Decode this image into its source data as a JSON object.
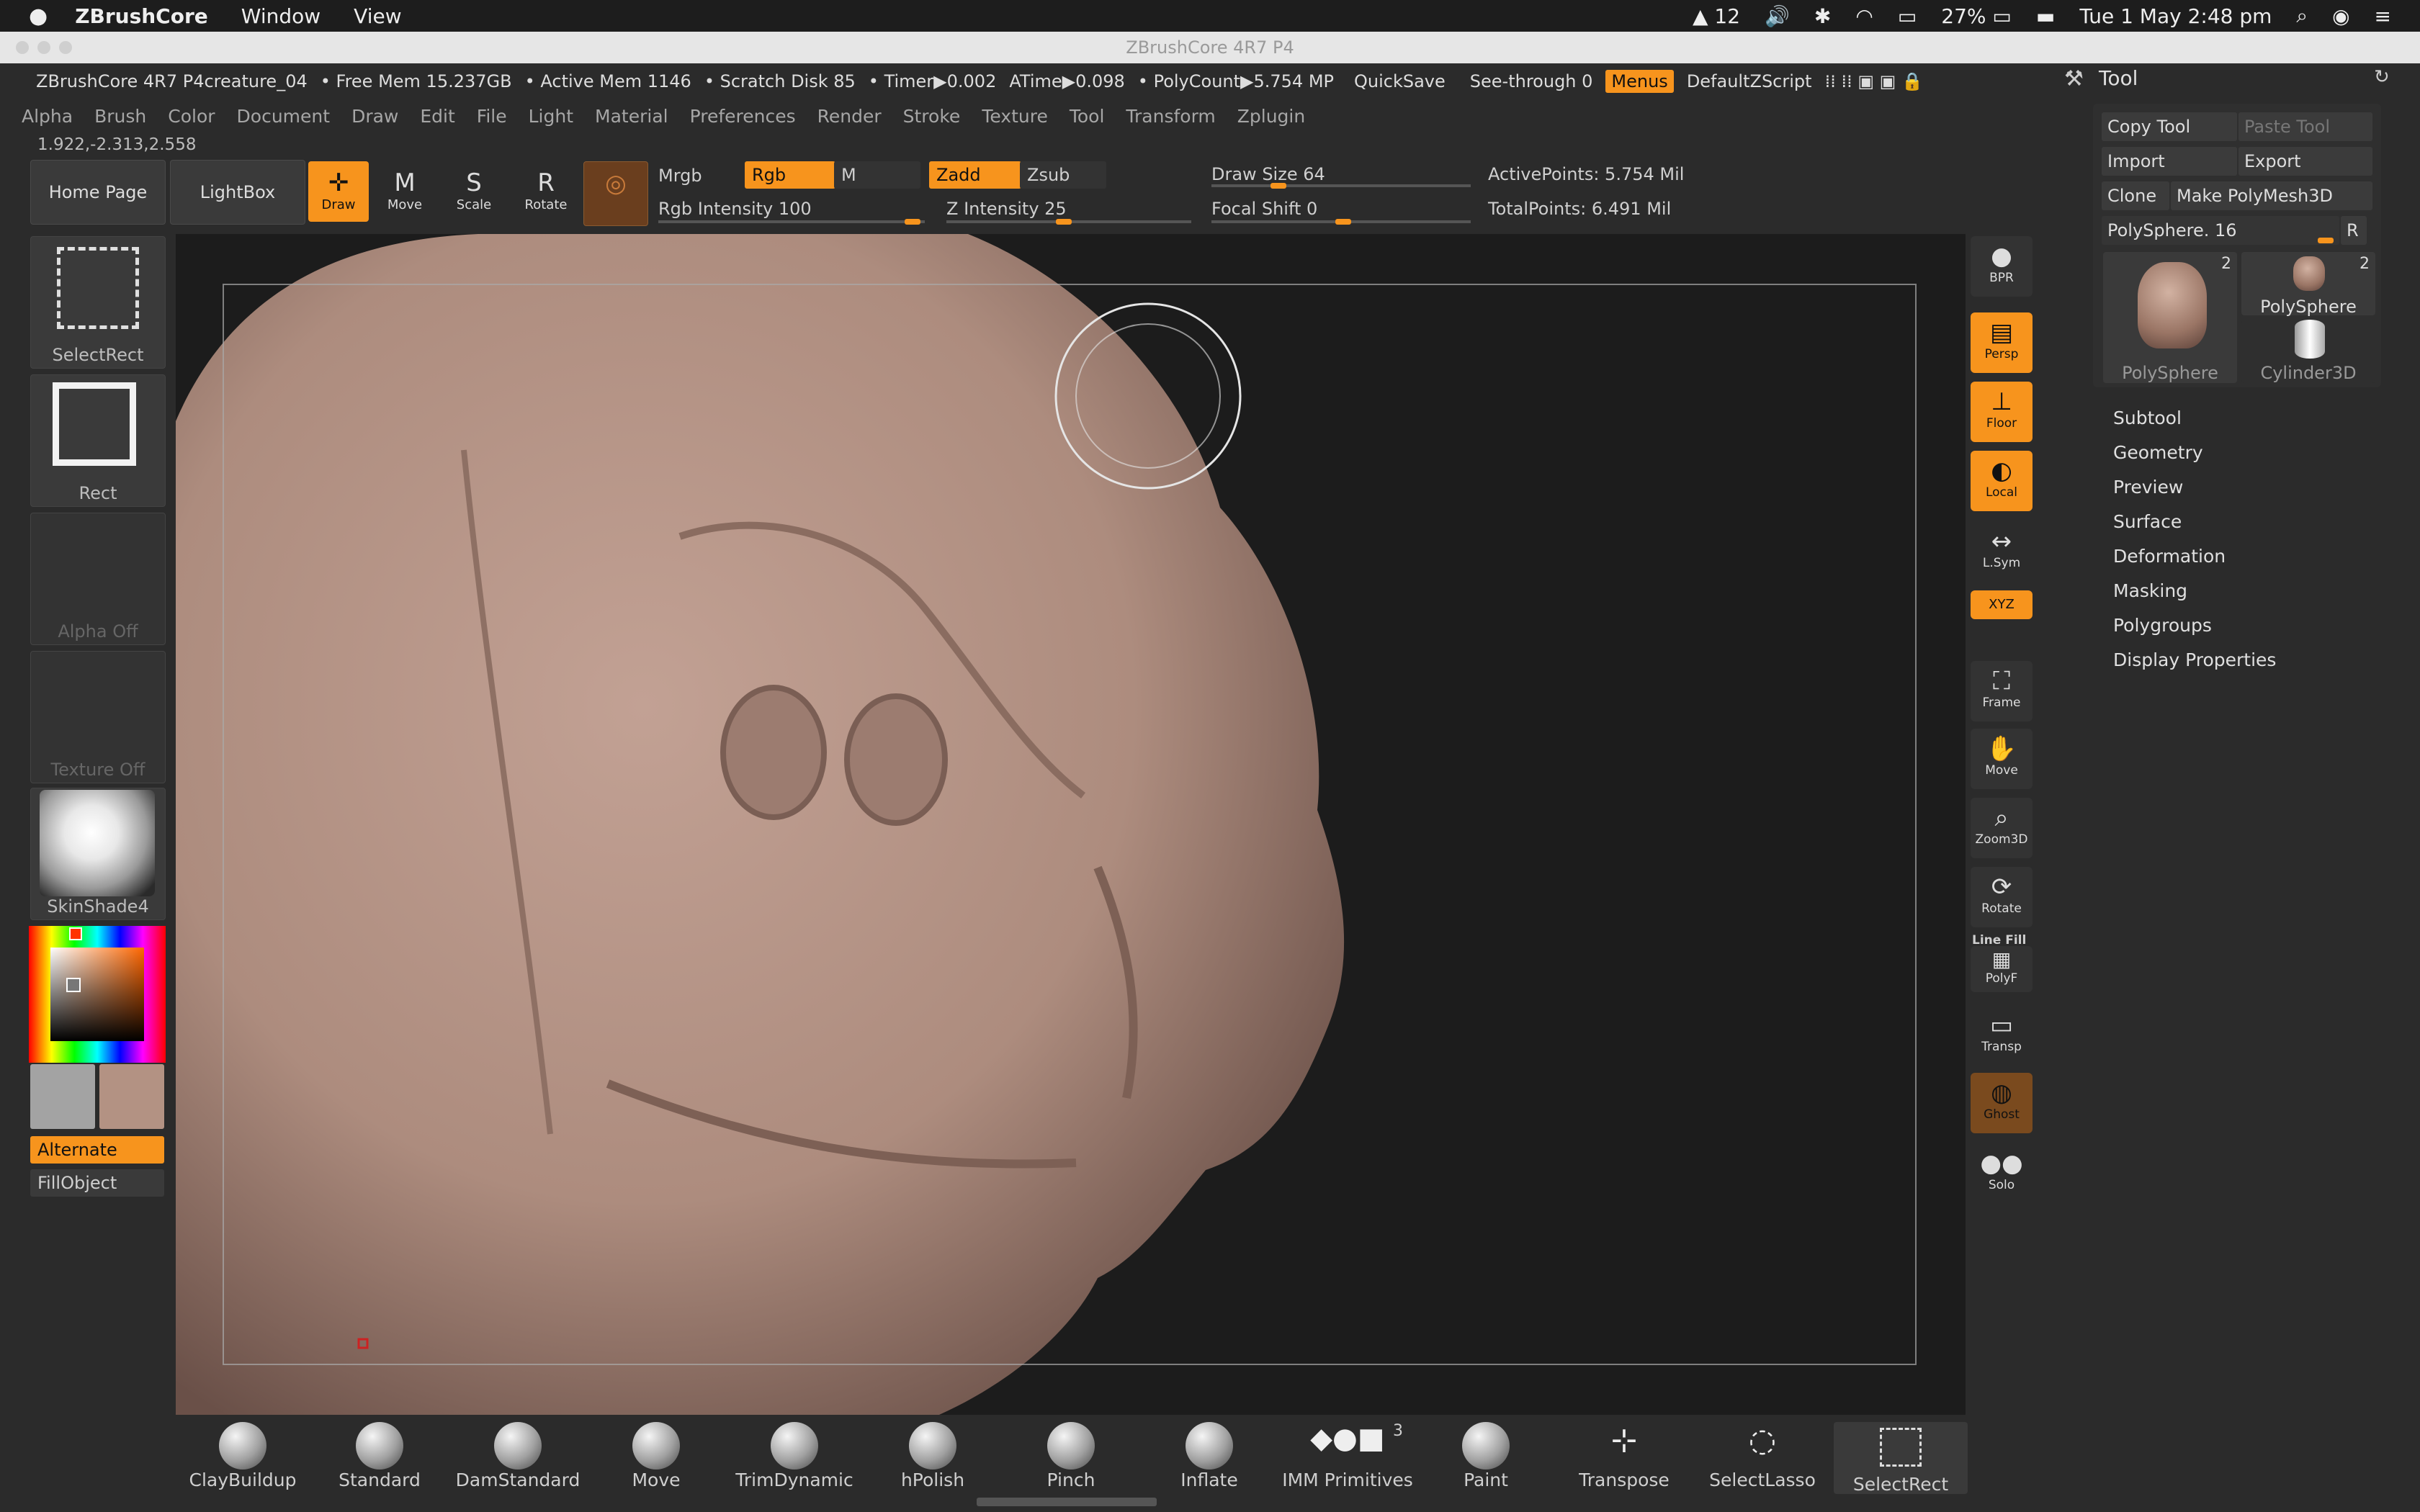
{
  "mac": {
    "app_name": "ZBrushCore",
    "menu": [
      "Window",
      "View"
    ],
    "status": {
      "adobe_count": "12",
      "battery": "27%",
      "datetime": "Tue 1 May  2:48 pm"
    }
  },
  "window": {
    "title": "ZBrushCore 4R7 P4"
  },
  "infobar": {
    "doc": "ZBrushCore 4R7 P4creature_04",
    "free_mem": "• Free Mem 15.237GB",
    "active_mem": "• Active Mem 1146",
    "scratch": "• Scratch Disk 85",
    "timer": "• Timer▶0.002",
    "atime": "ATime▶0.098",
    "polycount": "• PolyCount▶5.754 MP",
    "quicksave": "QuickSave",
    "see_through": "See-through   0",
    "menus": "Menus",
    "zscript": "DefaultZScript"
  },
  "menubar": [
    "Alpha",
    "Brush",
    "Color",
    "Document",
    "Draw",
    "Edit",
    "File",
    "Light",
    "Material",
    "Preferences",
    "Render",
    "Stroke",
    "Texture",
    "Tool",
    "Transform",
    "Zplugin"
  ],
  "coords": "1.922,-2.313,2.558",
  "toolbar": {
    "home": "Home Page",
    "lightbox": "LightBox",
    "draw": "Draw",
    "move": "Move",
    "scale": "Scale",
    "rotate": "Rotate",
    "mrgb": "Mrgb",
    "rgb": "Rgb",
    "m": "M",
    "zadd": "Zadd",
    "zsub": "Zsub",
    "rgb_intensity": "Rgb Intensity 100",
    "z_intensity": "Z Intensity 25",
    "draw_size": "Draw Size 64",
    "focal_shift": "Focal Shift 0",
    "active_points": "ActivePoints: 5.754 Mil",
    "total_points": "TotalPoints: 6.491 Mil"
  },
  "left": {
    "selectrect": "SelectRect",
    "rect": "Rect",
    "alpha": "Alpha Off",
    "texture": "Texture Off",
    "material": "SkinShade4",
    "alternate": "Alternate",
    "fillobject": "FillObject"
  },
  "right_shelf": [
    {
      "label": "BPR",
      "on": false
    },
    {
      "label": "Persp",
      "on": true
    },
    {
      "label": "Floor",
      "on": true
    },
    {
      "label": "Local",
      "on": true
    },
    {
      "label": "L.Sym",
      "on": false
    },
    {
      "label": "XYZ",
      "on": true
    },
    {
      "label": "Frame",
      "on": false
    },
    {
      "label": "Move",
      "on": false
    },
    {
      "label": "Zoom3D",
      "on": false
    },
    {
      "label": "Rotate",
      "on": false
    },
    {
      "label": "PolyF",
      "on": false
    },
    {
      "label": "Transp",
      "on": false
    },
    {
      "label": "Ghost",
      "on": true
    },
    {
      "label": "Solo",
      "on": false
    }
  ],
  "line_fill": "Line Fill",
  "tool": {
    "title": "Tool",
    "copy": "Copy Tool",
    "paste": "Paste Tool",
    "import": "Import",
    "export": "Export",
    "clone": "Clone",
    "make_polymesh": "Make PolyMesh3D",
    "polysphere_slider": "PolySphere. 16",
    "r": "R",
    "thumb1": "PolySphere",
    "thumb1_count": "2",
    "thumb2": "PolySphere",
    "thumb2_count": "2",
    "thumb3": "Cylinder3D",
    "menu": [
      "Subtool",
      "Geometry",
      "Preview",
      "Surface",
      "Deformation",
      "Masking",
      "Polygroups",
      "Display Properties"
    ]
  },
  "brushes": [
    "ClayBuildup",
    "Standard",
    "DamStandard",
    "Move",
    "TrimDynamic",
    "hPolish",
    "Pinch",
    "Inflate",
    "IMM Primitives",
    "Paint",
    "Transpose",
    "SelectLasso",
    "SelectRect"
  ],
  "imm_count": "3",
  "colors": {
    "accent": "#f7941d",
    "skin": "#b39283"
  }
}
